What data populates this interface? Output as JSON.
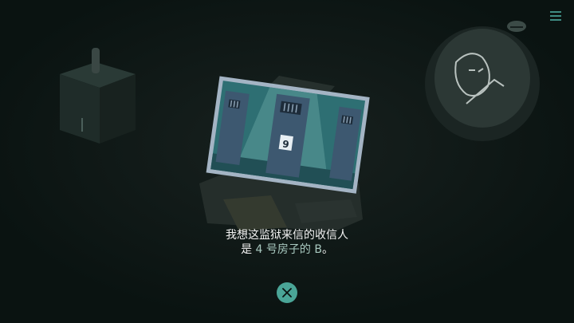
{
  "dialog": {
    "line1": "我想这监狱来信的收信人",
    "line2_pre": "是",
    "line2_highlight": "4 号房子的 B",
    "line2_post": "。"
  },
  "photo": {
    "door_number": "9"
  },
  "icons": {
    "menu": "hamburger-menu-icon",
    "close": "close-x-icon"
  },
  "colors": {
    "background": "#0a1311",
    "accent": "#4aa597",
    "photo_frame": "#7f95a8",
    "prison_wall": "#2e6f73",
    "door": "#3d5870"
  }
}
